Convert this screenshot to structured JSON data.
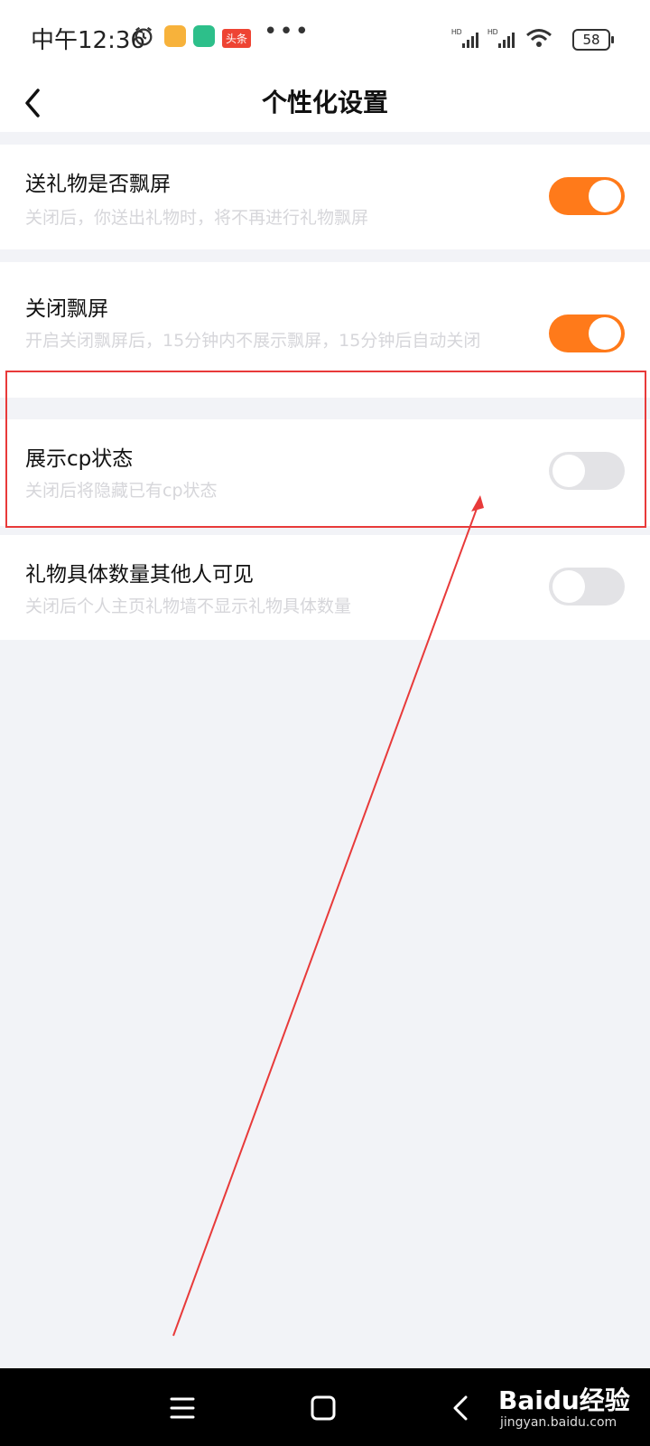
{
  "status": {
    "time": "中午12:36",
    "app_badge": "头条",
    "battery": "58"
  },
  "header": {
    "title": "个性化设置"
  },
  "settings": [
    {
      "title": "送礼物是否飘屏",
      "desc": "关闭后，你送出礼物时，将不再进行礼物飘屏",
      "enabled": true
    },
    {
      "title": "关闭飘屏",
      "desc": "开启关闭飘屏后，15分钟内不展示飘屏，15分钟后自动关闭",
      "enabled": true
    },
    {
      "title": "展示cp状态",
      "desc": "关闭后将隐藏已有cp状态",
      "enabled": false
    },
    {
      "title": "礼物具体数量其他人可见",
      "desc": "关闭后个人主页礼物墙不显示礼物具体数量",
      "enabled": false
    }
  ],
  "accent_color": "#ff7a1a",
  "annotation_color": "#e83a3a",
  "watermark": {
    "brand": "Baidu经验",
    "url": "jingyan.baidu.com"
  },
  "icons": [
    "alarm-icon",
    "app-icon",
    "shield-icon",
    "signal-icon",
    "wifi-icon",
    "battery-icon",
    "back-icon",
    "menu-icon",
    "home-icon",
    "back-nav-icon"
  ]
}
